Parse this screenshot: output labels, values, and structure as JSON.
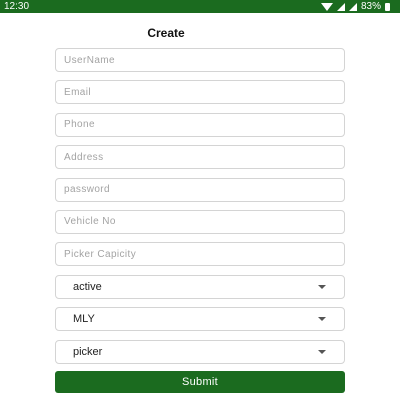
{
  "status_bar": {
    "time": "12:30",
    "battery_text": "83%"
  },
  "header": {
    "title": "Create"
  },
  "form": {
    "username_placeholder": "UserName",
    "email_placeholder": "Email",
    "phone_placeholder": "Phone",
    "address_placeholder": "Address",
    "password_placeholder": "password",
    "vehicle_placeholder": "Vehicle No",
    "capacity_placeholder": "Picker Capicity",
    "status_select": "active",
    "region_select": "MLY",
    "role_select": "picker",
    "submit_label": "Submit"
  },
  "colors": {
    "primary": "#1b6b1f",
    "border": "#d4d4d4"
  }
}
